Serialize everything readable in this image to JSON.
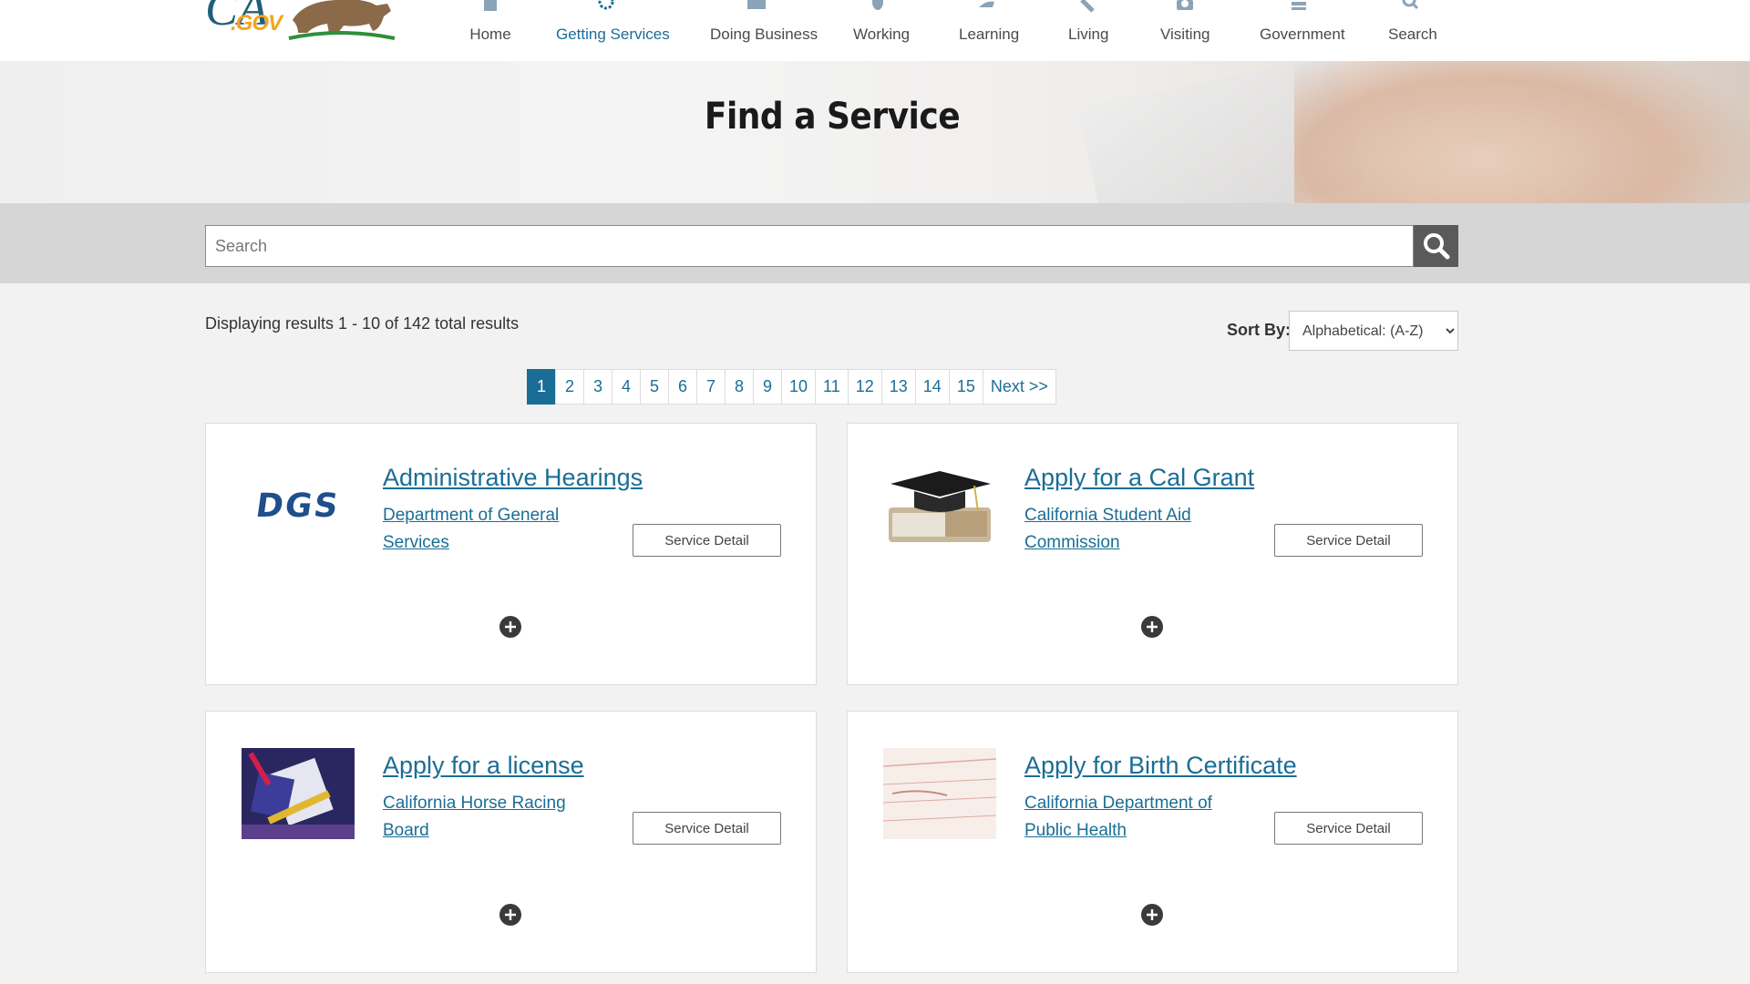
{
  "header": {
    "logo_text": "CA.GOV",
    "nav": [
      {
        "label": "Home",
        "icon": "home-icon",
        "active": false
      },
      {
        "label": "Getting Services",
        "icon": "gear-icon",
        "active": true
      },
      {
        "label": "Doing Business",
        "icon": "briefcase-icon",
        "active": false
      },
      {
        "label": "Working",
        "icon": "lightbulb-icon",
        "active": false
      },
      {
        "label": "Learning",
        "icon": "book-icon",
        "active": false
      },
      {
        "label": "Living",
        "icon": "tools-icon",
        "active": false
      },
      {
        "label": "Visiting",
        "icon": "camera-icon",
        "active": false
      },
      {
        "label": "Government",
        "icon": "capitol-icon",
        "active": false
      },
      {
        "label": "Search",
        "icon": "search-icon",
        "active": false
      }
    ]
  },
  "hero": {
    "title": "Find a Service"
  },
  "search": {
    "placeholder": "Search",
    "button_icon": "search-icon"
  },
  "results": {
    "summary": "Displaying results 1 - 10 of 142 total results",
    "sort_label": "Sort By:",
    "sort_selected": "Alphabetical: (A-Z)"
  },
  "pagination": {
    "pages": [
      "1",
      "2",
      "3",
      "4",
      "5",
      "6",
      "7",
      "8",
      "9",
      "10",
      "11",
      "12",
      "13",
      "14",
      "15"
    ],
    "current": "1",
    "next_label": "Next >>"
  },
  "services": [
    {
      "title": "Administrative Hearings",
      "agency": "Department of General Services",
      "button": "Service Detail",
      "thumb": "dgs-logo",
      "thumb_text": "DGS"
    },
    {
      "title": "Apply for a Cal Grant",
      "agency": "California Student Aid Commission",
      "button": "Service Detail",
      "thumb": "graduation-cap-image"
    },
    {
      "title": "Apply for a license",
      "agency": "California Horse Racing Board",
      "button": "Service Detail",
      "thumb": "license-collage-image"
    },
    {
      "title": "Apply for Birth Certificate",
      "agency": "California Department of Public Health",
      "button": "Service Detail",
      "thumb": "birth-certificate-image"
    }
  ],
  "colors": {
    "link": "#1a6e96",
    "logo_gold": "#f4a41b",
    "search_button": "#5a5a5a",
    "band": "#d6d6d6"
  }
}
